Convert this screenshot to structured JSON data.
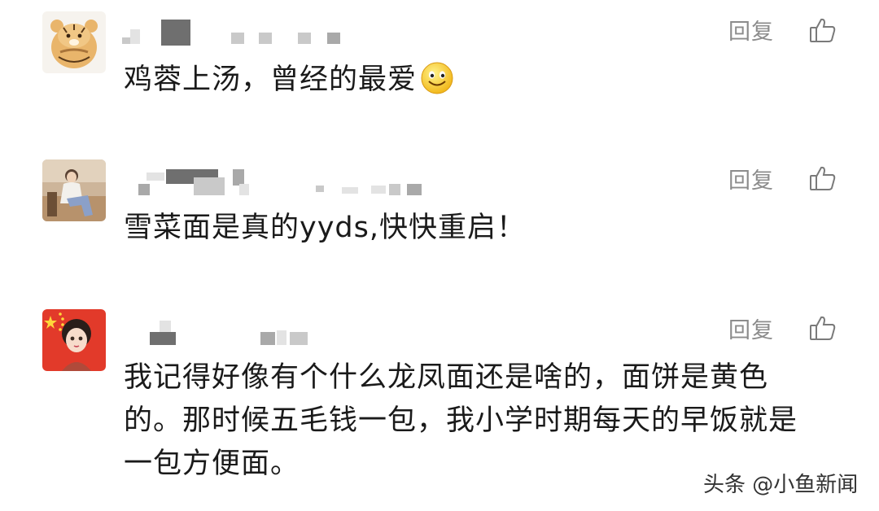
{
  "comments": [
    {
      "avatar_icon": "tiger-avatar-icon",
      "reply_label": "回复",
      "like_icon": "thumbs-up-icon",
      "text": "鸡蓉上汤，曾经的最爱",
      "emoji_icon": "smiling-face-icon"
    },
    {
      "avatar_icon": "woman-photo-avatar-icon",
      "reply_label": "回复",
      "like_icon": "thumbs-up-icon",
      "text": "雪菜面是真的yyds,快快重启！"
    },
    {
      "avatar_icon": "girl-flag-avatar-icon",
      "reply_label": "回复",
      "like_icon": "thumbs-up-icon",
      "text": "我记得好像有个什么龙凤面还是啥的，面饼是黄色\n的。那时候五毛钱一包，我小学时期每天的早饭就是\n一包方便面。"
    }
  ],
  "watermark": "头条 @小鱼新闻"
}
